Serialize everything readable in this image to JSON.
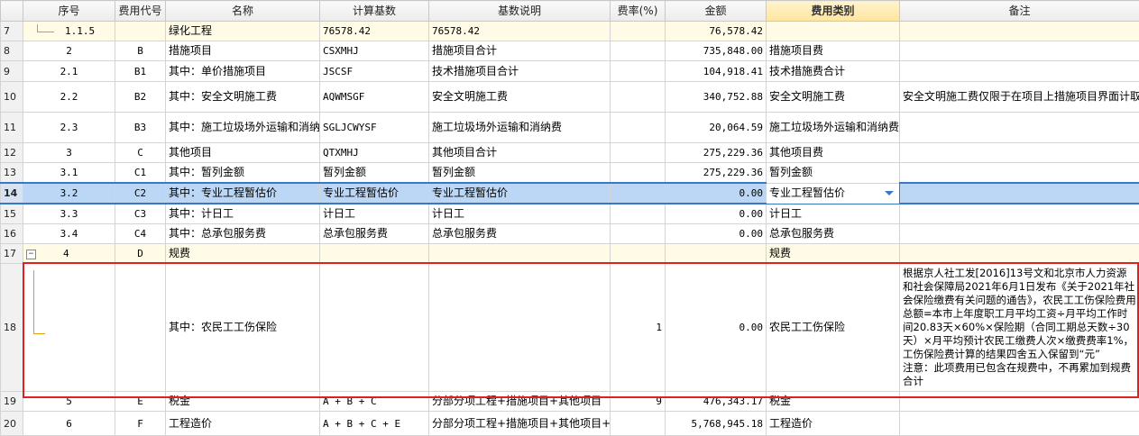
{
  "columns": {
    "rownum": "",
    "seq": "序号",
    "code": "费用代号",
    "name": "名称",
    "basis": "计算基数",
    "basis_desc": "基数说明",
    "rate": "费率(%)",
    "amount": "金额",
    "category": "费用类别",
    "note": "备注"
  },
  "rows": [
    {
      "rn": "7",
      "seq": "1.1.5",
      "code": "",
      "name": "绿化工程",
      "basis": "76578.42",
      "desc": "76578.42",
      "rate": "",
      "amount": "76,578.42",
      "cat": "",
      "note": ""
    },
    {
      "rn": "8",
      "seq": "2",
      "code": "B",
      "name": "措施项目",
      "basis": "CSXMHJ",
      "desc": "措施项目合计",
      "rate": "",
      "amount": "735,848.00",
      "cat": "措施项目费",
      "note": ""
    },
    {
      "rn": "9",
      "seq": "2.1",
      "code": "B1",
      "name": "其中：单价措施项目",
      "basis": "JSCSF",
      "desc": "技术措施项目合计",
      "rate": "",
      "amount": "104,918.41",
      "cat": "技术措施费合计",
      "note": ""
    },
    {
      "rn": "10",
      "seq": "2.2",
      "code": "B2",
      "name": "其中：安全文明施工费",
      "basis": "AQWMSGF",
      "desc": "安全文明施工费",
      "rate": "",
      "amount": "340,752.88",
      "cat": "安全文明施工费",
      "note": "安全文明施工费仅限于在项目上措施项目界面计取"
    },
    {
      "rn": "11",
      "seq": "2.3",
      "code": "B3",
      "name": "其中：施工垃圾场外运输和消纳费",
      "basis": "SGLJCWYSF",
      "desc": "施工垃圾场外运输和消纳费",
      "rate": "",
      "amount": "20,064.59",
      "cat": "施工垃圾场外运输和消纳费",
      "note": ""
    },
    {
      "rn": "12",
      "seq": "3",
      "code": "C",
      "name": "其他项目",
      "basis": "QTXMHJ",
      "desc": "其他项目合计",
      "rate": "",
      "amount": "275,229.36",
      "cat": "其他项目费",
      "note": ""
    },
    {
      "rn": "13",
      "seq": "3.1",
      "code": "C1",
      "name": "其中：暂列金额",
      "basis": "暂列金额",
      "desc": "暂列金额",
      "rate": "",
      "amount": "275,229.36",
      "cat": "暂列金额",
      "note": ""
    },
    {
      "rn": "14",
      "seq": "3.2",
      "code": "C2",
      "name": "其中：专业工程暂估价",
      "basis": "专业工程暂估价",
      "desc": "专业工程暂估价",
      "rate": "",
      "amount": "0.00",
      "cat": "专业工程暂估价",
      "note": ""
    },
    {
      "rn": "15",
      "seq": "3.3",
      "code": "C3",
      "name": "其中：计日工",
      "basis": "计日工",
      "desc": "计日工",
      "rate": "",
      "amount": "0.00",
      "cat": "计日工",
      "note": ""
    },
    {
      "rn": "16",
      "seq": "3.4",
      "code": "C4",
      "name": "其中：总承包服务费",
      "basis": "总承包服务费",
      "desc": "总承包服务费",
      "rate": "",
      "amount": "0.00",
      "cat": "总承包服务费",
      "note": ""
    },
    {
      "rn": "17",
      "seq": "4",
      "code": "D",
      "name": "规费",
      "basis": "",
      "desc": "",
      "rate": "",
      "amount": "",
      "cat": "规费",
      "note": "",
      "expander": "−"
    },
    {
      "rn": "18",
      "seq": "",
      "code": "",
      "name": "其中：农民工工伤保险",
      "basis": "",
      "desc": "",
      "rate": "1",
      "amount": "0.00",
      "cat": "农民工工伤保险",
      "note": "根据京人社工发[2016]13号文和北京市人力资源和社会保障局2021年6月1日发布《关于2021年社会保险缴费有关问题的通告》，农民工工伤保险费用总额=本市上年度职工月平均工资÷月平均工作时间20.83天×60%×保险期（合同工期总天数÷30天）×月平均预计农民工缴费人次×缴费费率1%，工伤保险费计算的结果四舍五入保留到“元”\n注意：此项费用已包含在规费中，不再累加到规费合计"
    },
    {
      "rn": "19",
      "seq": "5",
      "code": "E",
      "name": "税金",
      "basis": "A + B + C",
      "desc": "分部分项工程+措施项目+其他项目",
      "rate": "9",
      "amount": "476,343.17",
      "cat": "税金",
      "note": ""
    },
    {
      "rn": "20",
      "seq": "6",
      "code": "F",
      "name": "工程造价",
      "basis": "A + B + C + E",
      "desc": "分部分项工程+措施项目+其他项目+税金",
      "rate": "",
      "amount": "5,768,945.18",
      "cat": "工程造价",
      "note": ""
    }
  ]
}
